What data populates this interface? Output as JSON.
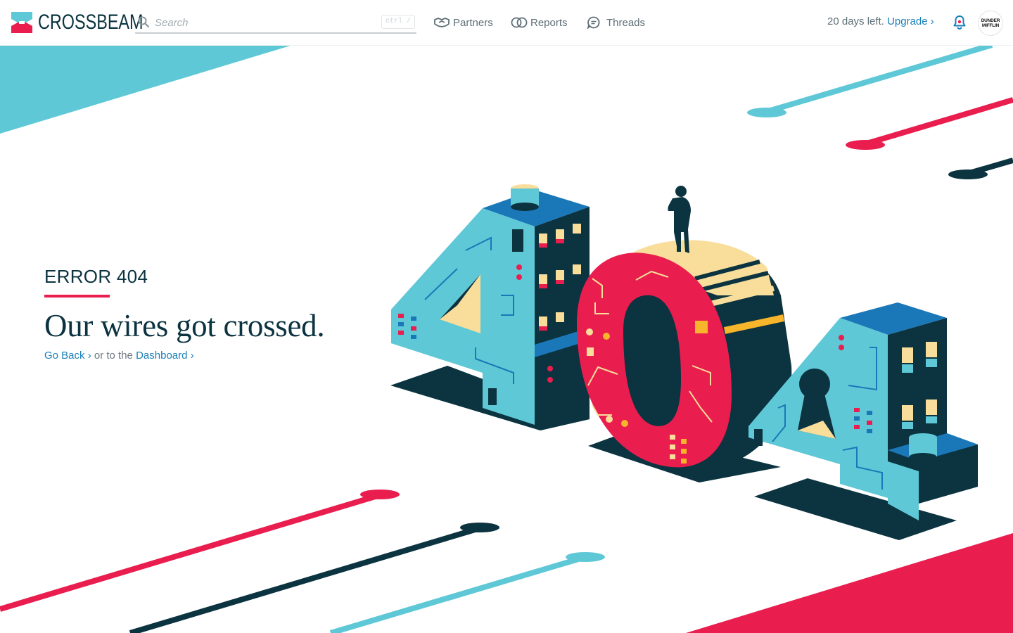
{
  "app": {
    "brand": "CROSSBEAM",
    "logo_icon": "crossbeam-logo-icon"
  },
  "search": {
    "placeholder": "Search",
    "value": "",
    "shortcut": "ctrl /",
    "icon": "search-icon"
  },
  "nav": [
    {
      "label": "Partners",
      "icon": "handshake-icon"
    },
    {
      "label": "Reports",
      "icon": "overlap-circles-icon"
    },
    {
      "label": "Threads",
      "icon": "chat-bubble-icon"
    }
  ],
  "trial": {
    "text": "20 days left.",
    "upgrade_label": "Upgrade ›"
  },
  "notifications": {
    "icon": "bell-icon"
  },
  "account": {
    "avatar_text_line1": "DUNDER",
    "avatar_text_line2": "MIFFLIN"
  },
  "error": {
    "label": "ERROR 404",
    "headline": "Our wires got crossed.",
    "go_back": "Go Back ›",
    "middle_text": "or to the",
    "dashboard": "Dashboard ›"
  },
  "colors": {
    "navy": "#0b3340",
    "teal": "#5fc8d6",
    "pink": "#e91e4f",
    "yellow": "#f9dd9a",
    "link": "#1a7fb8",
    "blue": "#1b78b8"
  }
}
